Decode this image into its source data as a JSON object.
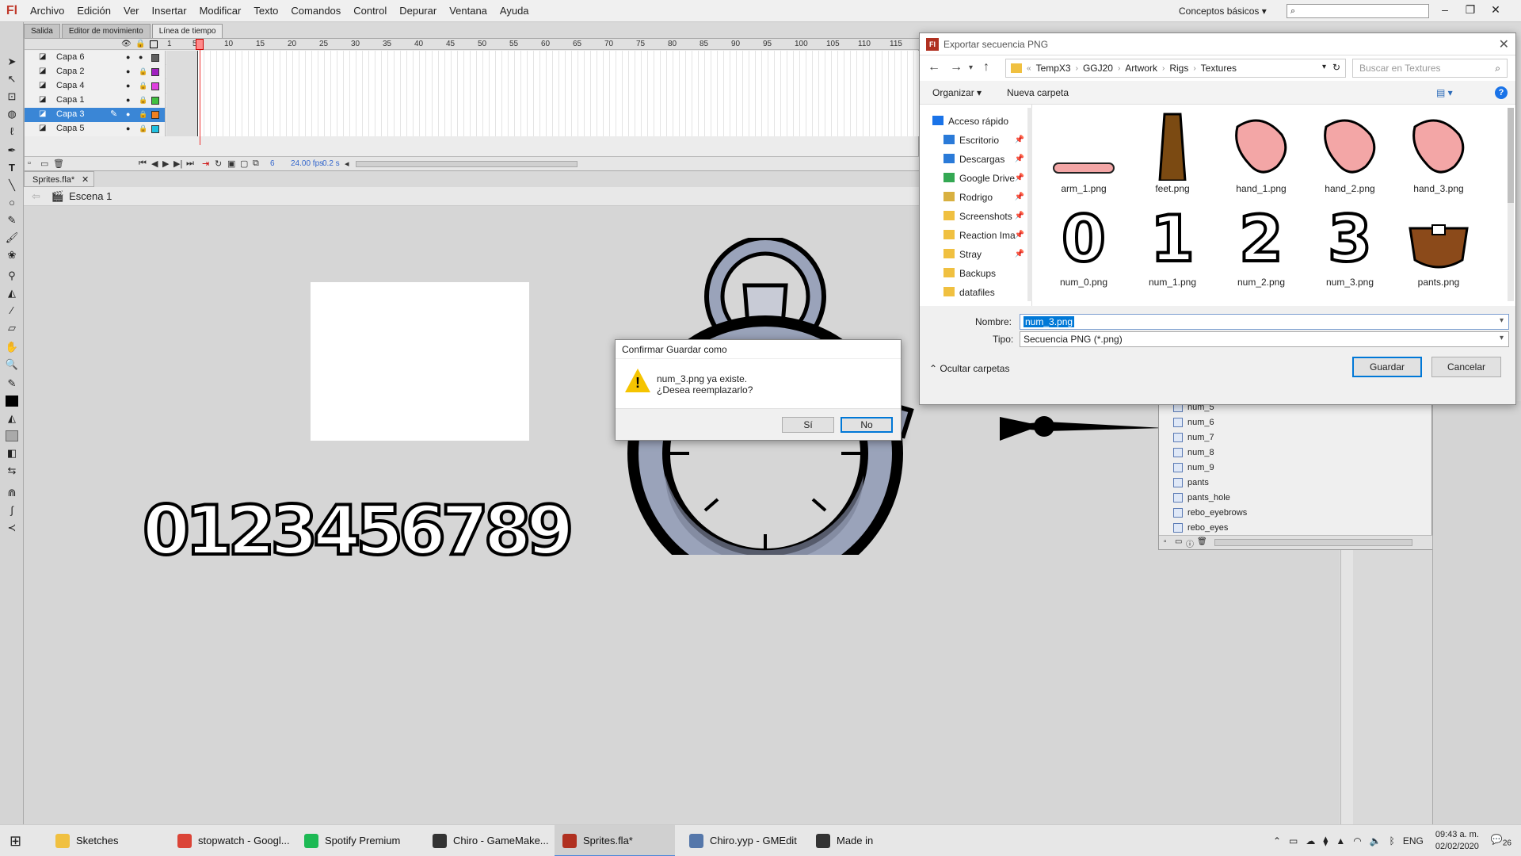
{
  "app": {
    "logo": "Fl",
    "menu": [
      "Archivo",
      "Edición",
      "Ver",
      "Insertar",
      "Modificar",
      "Texto",
      "Comandos",
      "Control",
      "Depurar",
      "Ventana",
      "Ayuda"
    ],
    "workspace": "Conceptos básicos",
    "search_placeholder": ""
  },
  "panel_tabs": [
    "Salida",
    "Editor de movimiento",
    "Línea de tiempo"
  ],
  "timeline": {
    "frame_numbers": [
      "1",
      "5",
      "10",
      "15",
      "20",
      "25",
      "30",
      "35",
      "40",
      "45",
      "50",
      "55",
      "60",
      "65",
      "70",
      "75",
      "80",
      "85",
      "90",
      "95",
      "100",
      "105",
      "110",
      "115"
    ],
    "layers": [
      {
        "name": "Capa 6",
        "color": "#606060",
        "selected": false
      },
      {
        "name": "Capa 2",
        "color": "#a020c0",
        "selected": false
      },
      {
        "name": "Capa 4",
        "color": "#e040e0",
        "selected": false
      },
      {
        "name": "Capa 1",
        "color": "#40c040",
        "selected": false
      },
      {
        "name": "Capa 3",
        "color": "#f08020",
        "selected": true
      },
      {
        "name": "Capa 5",
        "color": "#20c0e0",
        "selected": false
      }
    ],
    "current_frame": "6",
    "fps": "24.00 fps",
    "time": "0.2 s"
  },
  "document": {
    "tab_label": "Sprites.fla*",
    "scene": "Escena 1",
    "stage_digits": "0123456789"
  },
  "library": {
    "items": [
      "num_5",
      "num_6",
      "num_7",
      "num_8",
      "num_9",
      "pants",
      "pants_hole",
      "rebo_eyebrows",
      "rebo_eyes"
    ]
  },
  "file_dialog": {
    "title": "Exportar secuencia PNG",
    "breadcrumb": [
      "TempX3",
      "GGJ20",
      "Artwork",
      "Rigs",
      "Textures"
    ],
    "search_placeholder": "Buscar en Textures",
    "organize": "Organizar",
    "new_folder": "Nueva carpeta",
    "sidebar": [
      {
        "label": "Acceso rápido",
        "icon": "star-icon",
        "pinned": false,
        "color": "#1a73e8"
      },
      {
        "label": "Escritorio",
        "icon": "desktop-icon",
        "pinned": true,
        "color": "#2a7ad8"
      },
      {
        "label": "Descargas",
        "icon": "download-icon",
        "pinned": true,
        "color": "#2a7ad8"
      },
      {
        "label": "Google Drive",
        "icon": "google-drive-icon",
        "pinned": true,
        "color": "#34a853"
      },
      {
        "label": "Rodrigo",
        "icon": "user-folder-icon",
        "pinned": true,
        "color": "#d8b040"
      },
      {
        "label": "Screenshots",
        "icon": "folder-icon",
        "pinned": true,
        "color": "#f0c040"
      },
      {
        "label": "Reaction Ima",
        "icon": "folder-icon",
        "pinned": true,
        "color": "#f0c040"
      },
      {
        "label": "Stray",
        "icon": "folder-icon",
        "pinned": true,
        "color": "#f0c040"
      },
      {
        "label": "Backups",
        "icon": "folder-icon",
        "pinned": false,
        "color": "#f0c040"
      },
      {
        "label": "datafiles",
        "icon": "folder-icon",
        "pinned": false,
        "color": "#f0c040"
      }
    ],
    "files": [
      {
        "name": "arm_1.png",
        "thumb": "arm"
      },
      {
        "name": "feet.png",
        "thumb": "feet"
      },
      {
        "name": "hand_1.png",
        "thumb": "hand"
      },
      {
        "name": "hand_2.png",
        "thumb": "hand"
      },
      {
        "name": "hand_3.png",
        "thumb": "hand"
      },
      {
        "name": "num_0.png",
        "thumb": "0"
      },
      {
        "name": "num_1.png",
        "thumb": "1"
      },
      {
        "name": "num_2.png",
        "thumb": "2"
      },
      {
        "name": "num_3.png",
        "thumb": "3"
      },
      {
        "name": "pants.png",
        "thumb": "pants"
      }
    ],
    "name_label": "Nombre:",
    "name_value": "num_3.png",
    "type_label": "Tipo:",
    "type_value": "Secuencia PNG (*.png)",
    "hide_folders": "Ocultar carpetas",
    "save_label": "Guardar",
    "cancel_label": "Cancelar"
  },
  "confirm_dialog": {
    "title": "Confirmar Guardar como",
    "message_line1": "num_3.png ya existe.",
    "message_line2": "¿Desea reemplazarlo?",
    "yes_label": "Sí",
    "no_label": "No"
  },
  "taskbar": {
    "tasks": [
      {
        "label": "Sketches",
        "icon": "folder-icon",
        "color": "#f0c040",
        "active": false
      },
      {
        "label": "stopwatch - Googl...",
        "icon": "chrome-icon",
        "color": "#db4437",
        "active": false
      },
      {
        "label": "Spotify Premium",
        "icon": "spotify-icon",
        "color": "#1db954",
        "active": false
      },
      {
        "label": "Chiro - GameMake...",
        "icon": "gamemaker-icon",
        "color": "#333333",
        "active": false
      },
      {
        "label": "Sprites.fla*",
        "icon": "flash-icon",
        "color": "#b03020",
        "active": true
      },
      {
        "label": "Chiro.yyp - GMEdit",
        "icon": "gmedit-icon",
        "color": "#5577aa",
        "active": false
      },
      {
        "label": "Made in GameMak...",
        "icon": "gamemaker-icon",
        "color": "#333333",
        "active": false
      }
    ],
    "language": "ENG",
    "time": "09:43 a. m.",
    "date": "02/02/2020",
    "notifications": "26"
  }
}
